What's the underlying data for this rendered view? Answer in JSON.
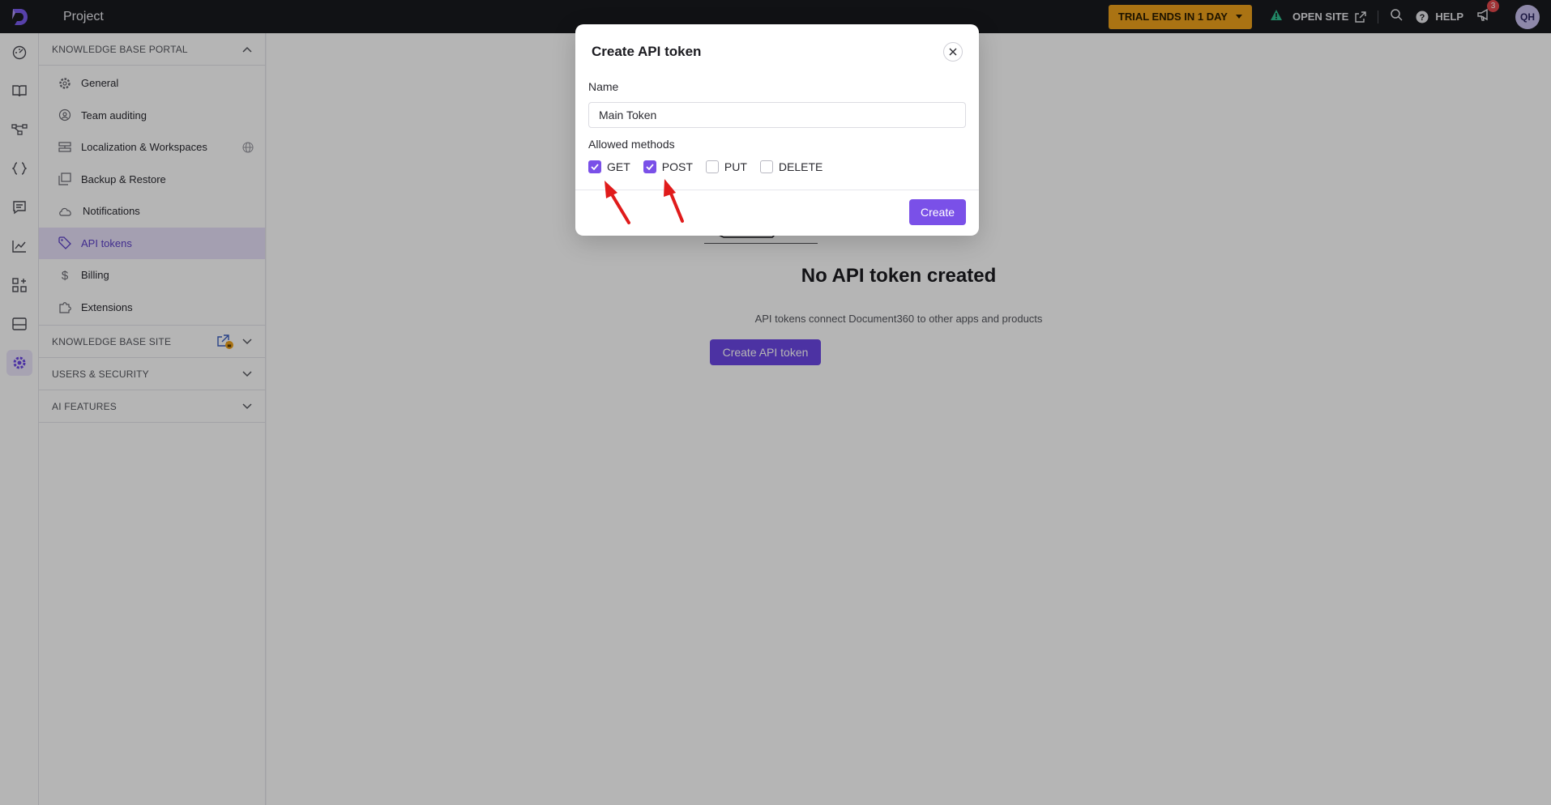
{
  "topbar": {
    "project": "Project",
    "trial": "TRIAL ENDS IN 1 DAY",
    "open_site": "OPEN SITE",
    "help": "HELP",
    "notifications_count": "3",
    "avatar_initials": "QH"
  },
  "sidebar": {
    "portal_header": "KNOWLEDGE BASE PORTAL",
    "items": [
      {
        "label": "General",
        "icon": "gear-icon"
      },
      {
        "label": "Team auditing",
        "icon": "audit-icon"
      },
      {
        "label": "Localization & Workspaces",
        "icon": "layers-icon"
      },
      {
        "label": "Backup & Restore",
        "icon": "backup-icon"
      },
      {
        "label": "Notifications",
        "icon": "cloud-bell-icon"
      },
      {
        "label": "API tokens",
        "icon": "tag-icon"
      },
      {
        "label": "Billing",
        "icon": "dollar-icon"
      },
      {
        "label": "Extensions",
        "icon": "puzzle-icon"
      }
    ],
    "site_header": "KNOWLEDGE BASE SITE",
    "users_header": "USERS & SECURITY",
    "ai_header": "AI FEATURES"
  },
  "main": {
    "empty_title": "No API token created",
    "empty_subtitle": "API tokens connect Document360 to other apps and products",
    "create_button": "Create API token"
  },
  "modal": {
    "title": "Create API token",
    "name_label": "Name",
    "name_value": "Main Token",
    "methods_label": "Allowed methods",
    "methods": [
      {
        "label": "GET",
        "checked": true
      },
      {
        "label": "POST",
        "checked": true
      },
      {
        "label": "PUT",
        "checked": false
      },
      {
        "label": "DELETE",
        "checked": false
      }
    ],
    "create_label": "Create"
  },
  "colors": {
    "accent": "#7a50e8",
    "trial": "#f0a21b",
    "annotation": "#e01b1b"
  }
}
